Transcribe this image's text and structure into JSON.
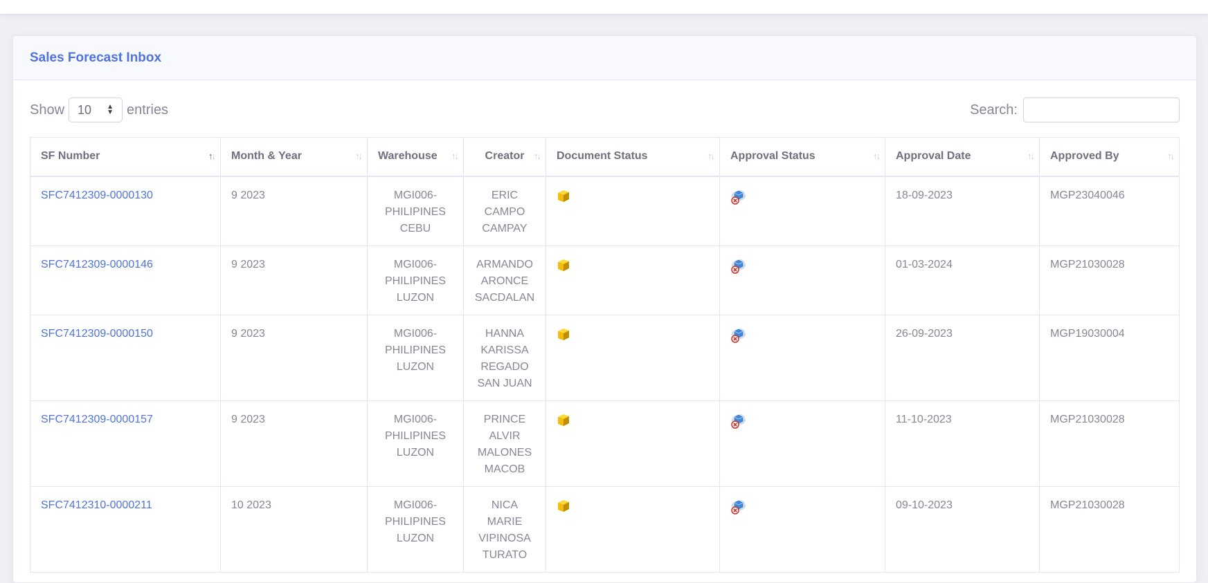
{
  "card": {
    "title": "Sales Forecast Inbox"
  },
  "controls": {
    "show_label": "Show",
    "entries_value": "10",
    "entries_label": "entries",
    "search_label": "Search:",
    "search_value": ""
  },
  "table": {
    "columns": [
      "SF Number",
      "Month & Year",
      "Warehouse",
      "Creator",
      "Document Status",
      "Approval Status",
      "Approval Date",
      "Approved By"
    ],
    "rows": [
      {
        "sf_number": "SFC7412309-0000130",
        "month_year": "9 2023",
        "warehouse": [
          "MGI006-",
          "PHILIPINES",
          "CEBU"
        ],
        "creator": [
          "ERIC",
          "CAMPO",
          "CAMPAY"
        ],
        "document_status_icon": "folder-icon",
        "approval_status_icon": "cloud-rejected-icon",
        "approval_date": "18-09-2023",
        "approved_by": "MGP23040046"
      },
      {
        "sf_number": "SFC7412309-0000146",
        "month_year": "9 2023",
        "warehouse": [
          "MGI006-",
          "PHILIPINES",
          "LUZON"
        ],
        "creator": [
          "ARMANDO",
          "ARONCE",
          "SACDALAN"
        ],
        "document_status_icon": "folder-icon",
        "approval_status_icon": "cloud-rejected-icon",
        "approval_date": "01-03-2024",
        "approved_by": "MGP21030028"
      },
      {
        "sf_number": "SFC7412309-0000150",
        "month_year": "9 2023",
        "warehouse": [
          "MGI006-",
          "PHILIPINES",
          "LUZON"
        ],
        "creator": [
          "HANNA",
          "KARISSA",
          "REGADO",
          "SAN JUAN"
        ],
        "document_status_icon": "folder-icon",
        "approval_status_icon": "cloud-rejected-icon",
        "approval_date": "26-09-2023",
        "approved_by": "MGP19030004"
      },
      {
        "sf_number": "SFC7412309-0000157",
        "month_year": "9 2023",
        "warehouse": [
          "MGI006-",
          "PHILIPINES",
          "LUZON"
        ],
        "creator": [
          "PRINCE",
          "ALVIR",
          "MALONES",
          "MACOB"
        ],
        "document_status_icon": "folder-icon",
        "approval_status_icon": "cloud-rejected-icon",
        "approval_date": "11-10-2023",
        "approved_by": "MGP21030028"
      },
      {
        "sf_number": "SFC7412310-0000211",
        "month_year": "10 2023",
        "warehouse": [
          "MGI006-",
          "PHILIPINES",
          "LUZON"
        ],
        "creator": [
          "NICA",
          "MARIE",
          "VIPINOSA",
          "TURATO"
        ],
        "document_status_icon": "folder-icon",
        "approval_status_icon": "cloud-rejected-icon",
        "approval_date": "09-10-2023",
        "approved_by": "MGP21030028"
      }
    ]
  },
  "colors": {
    "accent": "#4e73df",
    "text": "#858796",
    "header_text": "#6e707e",
    "border": "#e3e6f0",
    "page_bg": "#eef0f4"
  }
}
